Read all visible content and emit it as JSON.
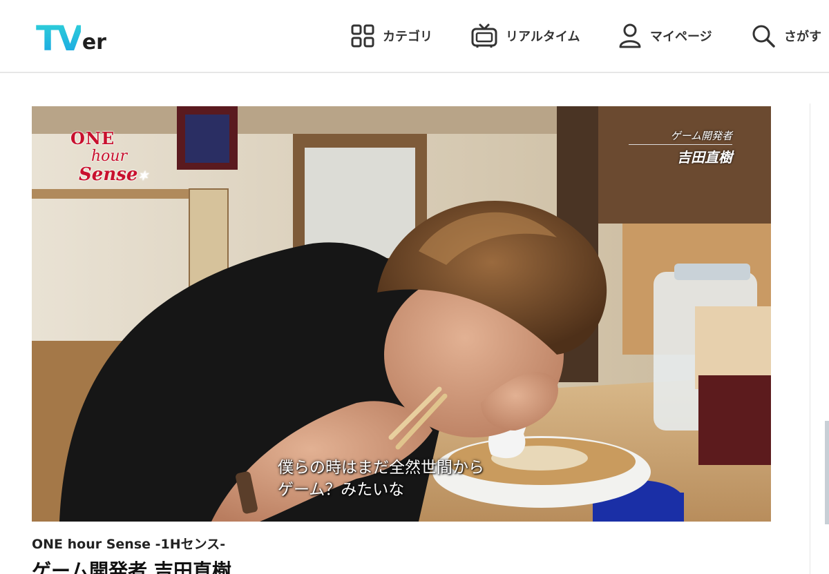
{
  "header": {
    "logo_tv": "TV",
    "logo_er": "er",
    "nav": {
      "category": "カテゴリ",
      "realtime": "リアルタイム",
      "mypage": "マイページ",
      "search": "さがす"
    }
  },
  "player": {
    "brand": {
      "line1": "ONE",
      "line2": "hour",
      "line3": "Sense"
    },
    "tag_role": "ゲーム開発者",
    "tag_name": "吉田直樹",
    "subtitles": [
      "僕らの時はまだ全然世間から",
      "ゲーム？みたいな"
    ]
  },
  "program": {
    "series": "ONE hour Sense -1Hセンス-",
    "episode": "ゲーム開発者 吉田直樹"
  },
  "colors": {
    "logo_cyan": "#2fd0d8",
    "logo_blue": "#1aa6e3",
    "brand_red": "#c8102e"
  }
}
